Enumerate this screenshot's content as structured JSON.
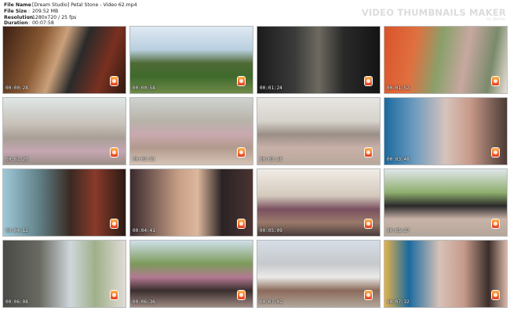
{
  "file_info": [
    {
      "key": "File Name",
      "value": "[Dream Studio] Petal Stone - Video 62.mp4"
    },
    {
      "key": "File Size",
      "value": "209.52 MB"
    },
    {
      "key": "Resolution",
      "value": "1280x720 / 25 fps"
    },
    {
      "key": "Duration",
      "value": "00:07:58"
    }
  ],
  "brand": {
    "title": "VIDEO THUMBNAILS MAKER",
    "subtitle": "by Bolide"
  },
  "thumbnails": [
    {
      "time": "00:00:28",
      "bg": "linear-gradient(110deg,#3b1f12 0%,#8a5a34 30%,#caa07a 45%,#2a2a2a 60%,#7a3020 80%,#2f1a10 100%)"
    },
    {
      "time": "00:00:58",
      "bg": "linear-gradient(180deg,#dfe9f2 0%,#b9cfe0 35%,#4f6a36 55%,#3f6a2c 75%,#6f8a4a 100%)"
    },
    {
      "time": "00:01:24",
      "bg": "linear-gradient(90deg,#1b1b1b 0%,#3a3a3a 30%,#6e6a60 50%,#2a2a2a 70%,#141414 100%)"
    },
    {
      "time": "00:01:52",
      "bg": "linear-gradient(100deg,#d9532a 0%,#e07040 25%,#8aa06a 45%,#c7a8a0 65%,#7a8a6a 85%,#e8e0d8 100%)"
    },
    {
      "time": "00:02:20",
      "bg": "linear-gradient(180deg,#dfe7e6 0%,#c7c0b8 40%,#a89f96 60%,#c5a6b2 80%,#9c8f86 100%)"
    },
    {
      "time": "00:02:51",
      "bg": "linear-gradient(180deg,#cfd3d0 0%,#b8b3a9 35%,#c9a8b0 55%,#b19a8c 75%,#d5c3b6 100%)"
    },
    {
      "time": "00:03:16",
      "bg": "linear-gradient(180deg,#e8e6e2 0%,#d6d2cc 35%,#9a8e86 55%,#c8b0a8 75%,#b9a89a 100%)"
    },
    {
      "time": "00:03:48",
      "bg": "linear-gradient(90deg,#1a6aa0 0%,#6f9cbf 25%,#d7c3bc 50%,#c89a8a 70%,#4a3a34 100%)"
    },
    {
      "time": "00:04:12",
      "bg": "linear-gradient(90deg,#9fc9d8 0%,#5f7f86 30%,#3a2a22 55%,#8a3a2a 75%,#2a1a14 100%)"
    },
    {
      "time": "00:04:41",
      "bg": "linear-gradient(90deg,#3a2a2e 0%,#c8a088 40%,#dcb79c 55%,#2a2224 75%,#4a3432 100%)"
    },
    {
      "time": "00:05:09",
      "bg": "linear-gradient(180deg,#f0ece6 0%,#d4c9bc 40%,#7a5060 60%,#9a7a6a 80%,#4a3a3a 100%)"
    },
    {
      "time": "00:05:37",
      "bg": "linear-gradient(180deg,#dfe6ea 0%,#8fae6e 35%,#2a2a2a 55%,#c9b3a8 75%,#b3a69a 100%)"
    },
    {
      "time": "00:06:08",
      "bg": "linear-gradient(90deg,#4a4a46 0%,#6a6a62 30%,#cfd7dc 55%,#9fb08a 75%,#e0dcd6 100%)"
    },
    {
      "time": "00:06:36",
      "bg": "linear-gradient(180deg,#cfe0ea 0%,#7c9a5a 35%,#b37a92 55%,#3a2e2e 75%,#9e8a82 100%)"
    },
    {
      "time": "00:07:02",
      "bg": "linear-gradient(180deg,#d6dde6 0%,#c6c9cc 35%,#eaeae8 55%,#8a6a5a 75%,#b3a79c 100%)"
    },
    {
      "time": "00:07:32",
      "bg": "linear-gradient(90deg,#e4b24a 0%,#1a6aa0 20%,#d8c2b8 45%,#c69a8a 65%,#3a2e2a 85%,#d9b7a8 100%)"
    }
  ]
}
